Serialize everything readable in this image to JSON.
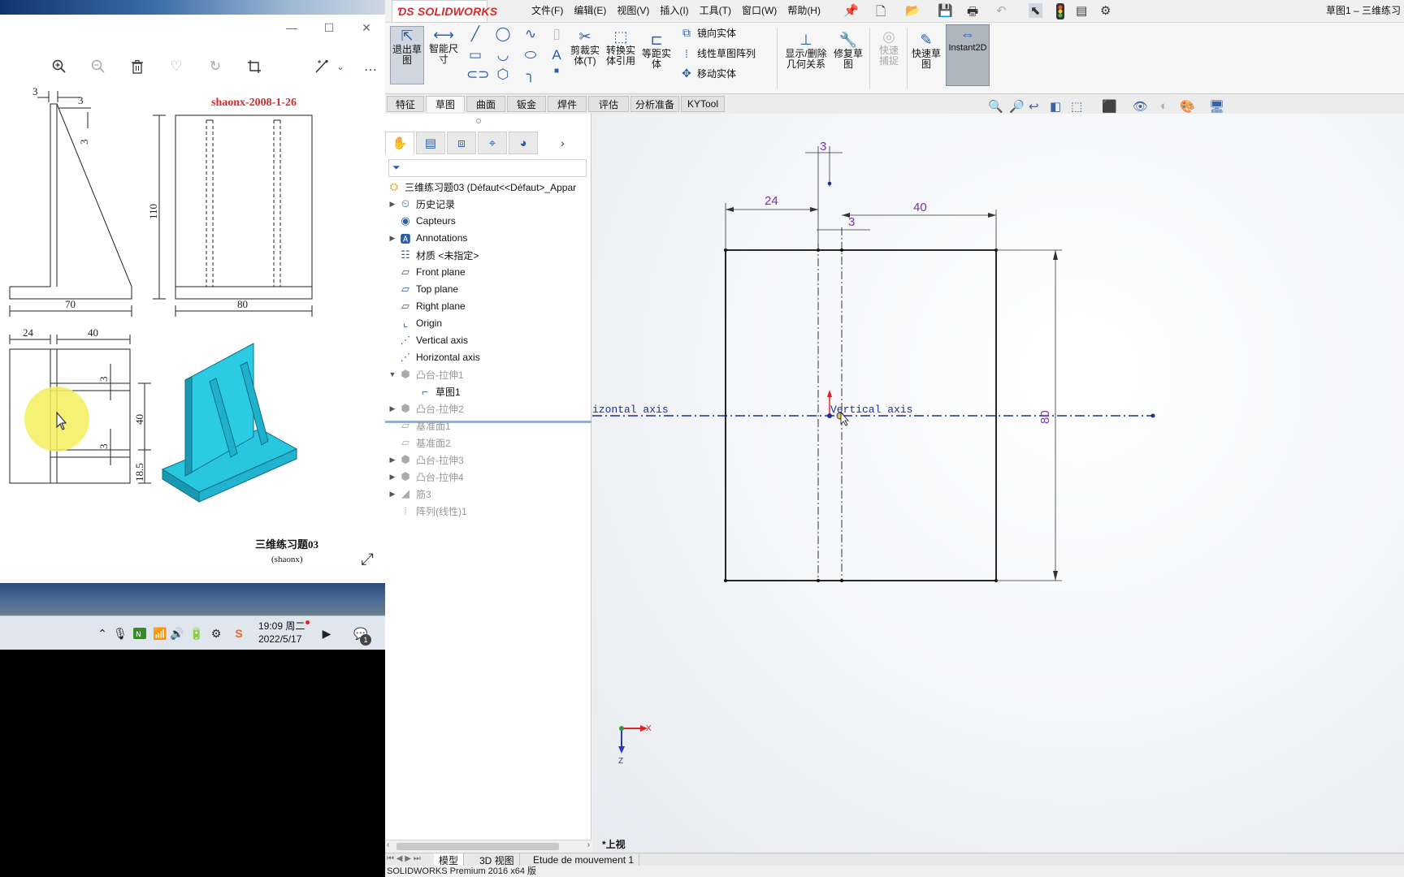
{
  "photo_viewer": {
    "window_controls": [
      "—",
      "☐",
      "✕"
    ],
    "toolbar": [
      "zoom-in",
      "zoom-out",
      "delete",
      "favorite",
      "rotate",
      "crop",
      "edit",
      "more"
    ],
    "more_label": "…",
    "drawing": {
      "watermark": "shaonx-2008-1-26",
      "title": "三维练习题03",
      "subtitle": "(shaonx)",
      "dims": {
        "top_3a": "3",
        "top_3b": "3",
        "side_3": "3",
        "height_110": "110",
        "width_70": "70",
        "width_80": "80",
        "plan_24": "24",
        "plan_40": "40",
        "plan_3a": "3",
        "plan_3b": "3",
        "plan_40v": "40",
        "plan_18_5": "18.5"
      }
    }
  },
  "taskbar": {
    "time": "19:09 周二",
    "date": "2022/5/17",
    "notification_count": "1"
  },
  "sw": {
    "logo": "SOLIDWORKS",
    "menu": [
      "文件(F)",
      "编辑(E)",
      "视图(V)",
      "插入(I)",
      "工具(T)",
      "窗口(W)",
      "帮助(H)"
    ],
    "title_right": "草图1 – 三维练习",
    "ribbon": {
      "exit_sketch": "退出草图",
      "smart_dim": "智能尺寸",
      "trim": "剪裁实体(T)",
      "convert": "转换实体引用",
      "offset": "等距实体",
      "mirror": "镜向实体",
      "linear_pattern": "线性草图阵列",
      "move": "移动实体",
      "show_relations": "显示/删除几何关系",
      "repair": "修复草图",
      "quick_snap": "快速捕捉",
      "rapid_sketch": "快速草图",
      "instant2d": "Instant2D"
    },
    "command_tabs": [
      "特征",
      "草图",
      "曲面",
      "钣金",
      "焊件",
      "评估",
      "分析准备",
      "KYTool"
    ],
    "active_tab": "草图",
    "tree": {
      "root": "三维练习题03  (Défaut<<Défaut>_Appar",
      "items": [
        {
          "label": "历史记录"
        },
        {
          "label": "Capteurs"
        },
        {
          "label": "Annotations"
        },
        {
          "label": "材质 <未指定>"
        },
        {
          "label": "Front plane"
        },
        {
          "label": "Top plane"
        },
        {
          "label": "Right plane"
        },
        {
          "label": "Origin"
        },
        {
          "label": "Vertical axis"
        },
        {
          "label": "Horizontal axis"
        },
        {
          "label": "凸台-拉伸1"
        },
        {
          "label": "草图1"
        },
        {
          "label": "凸台-拉伸2"
        },
        {
          "label": "基准面1"
        },
        {
          "label": "基准面2"
        },
        {
          "label": "凸台-拉伸3"
        },
        {
          "label": "凸台-拉伸4"
        },
        {
          "label": "筋3"
        },
        {
          "label": "阵列(线性)1"
        }
      ]
    },
    "viewport": {
      "dim_3_top": "3",
      "dim_24": "24",
      "dim_40": "40",
      "dim_3_mid": "3",
      "dim_80": "80",
      "horizontal_axis_label": "izontal axis",
      "vertical_axis_label": "Vertical axis",
      "view_label": "*上视",
      "triad_x": "X",
      "triad_z": "Z"
    },
    "bottom_tabs": [
      "模型",
      "3D 视图",
      "Etude de mouvement 1"
    ],
    "status": "SOLIDWORKS Premium 2016 x64 版"
  },
  "colors": {
    "accent_blue": "#2a5ea6",
    "dim_purple": "#7a2fb0",
    "model_cyan": "#29c6e0",
    "sw_red": "#d62b2b",
    "highlight_yellow": "#f3ee5c"
  }
}
